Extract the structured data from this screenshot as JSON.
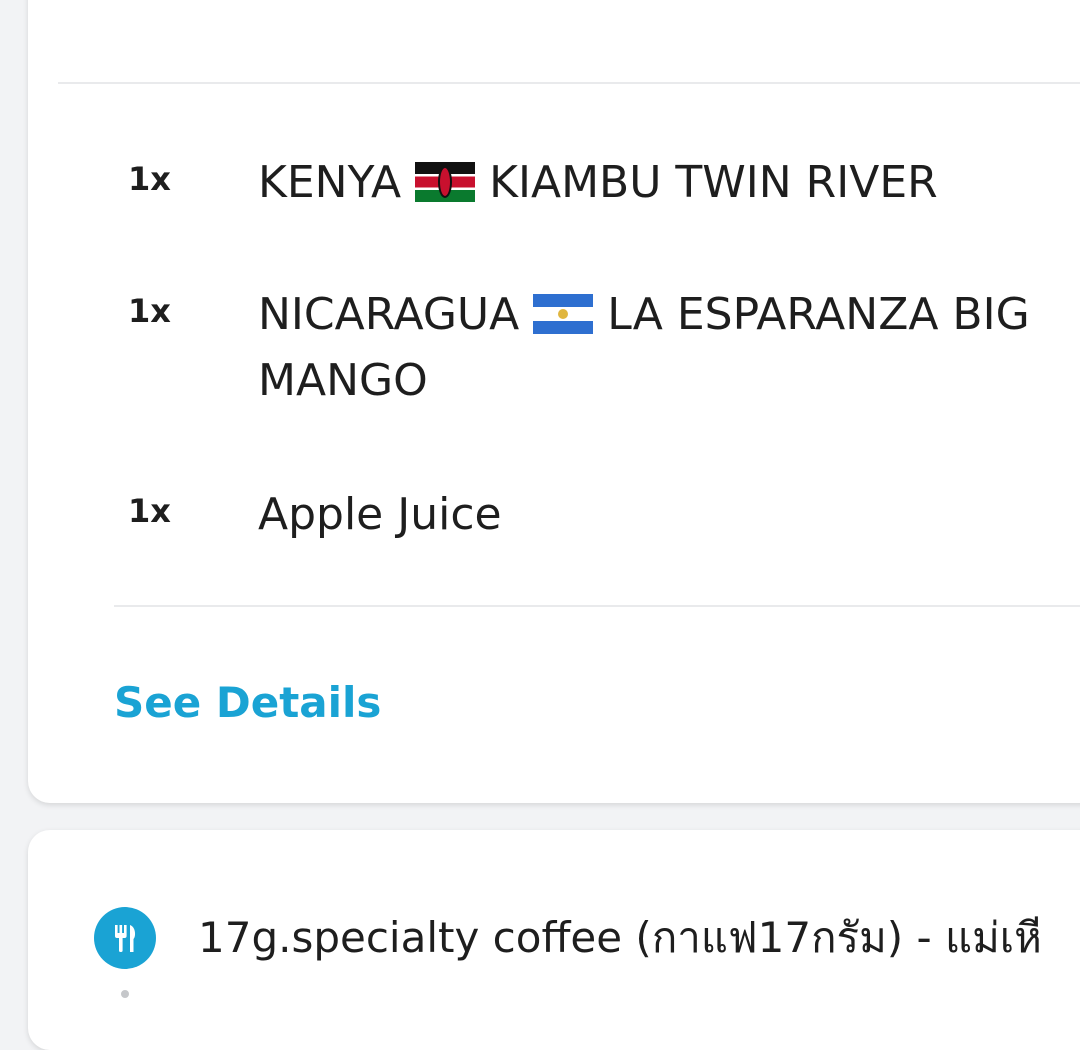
{
  "order": {
    "items": [
      {
        "qty": "1x",
        "name_before": "KENYA",
        "flag": "kenya-flag",
        "name_after": "KIAMBU TWIN RIVER"
      },
      {
        "qty": "1x",
        "name_before": "NICARAGUA",
        "flag": "nicaragua-flag",
        "name_after": "LA ESPARANZA BIG MANGO"
      },
      {
        "qty": "1x",
        "name": "Apple Juice"
      }
    ],
    "see_details_label": "See Details"
  },
  "restaurant": {
    "icon": "cutlery-icon",
    "name": "17g.specialty coffee (กาแฟ17กรัม) - แม่เหี"
  },
  "colors": {
    "accent": "#1aa3d4",
    "background": "#f2f3f5",
    "card": "#ffffff"
  }
}
